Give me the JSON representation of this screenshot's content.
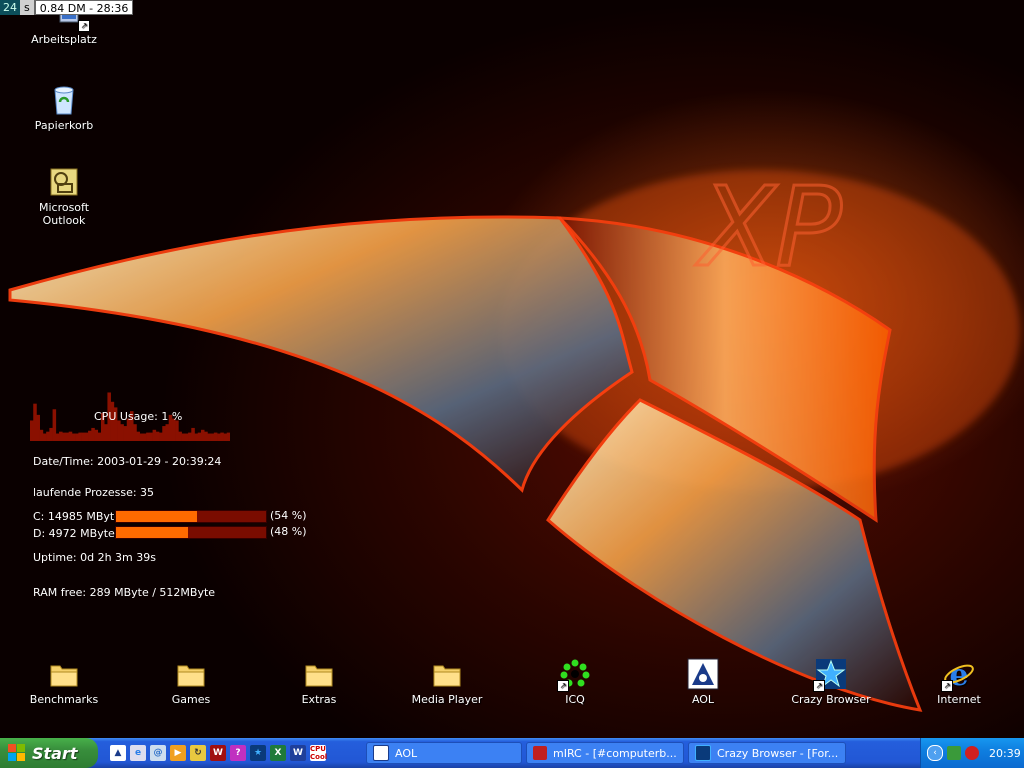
{
  "topbar": {
    "seconds": "24",
    "s": "s",
    "clock": "0.84 DM - 28:36"
  },
  "desktop_icons": {
    "arbeitsplatz": "Arbeitsplatz",
    "papierkorb": "Papierkorb",
    "outlook": "Microsoft Outlook",
    "benchmarks": "Benchmarks",
    "games": "Games",
    "extras": "Extras",
    "media_player": "Media Player",
    "icq": "ICQ",
    "aol": "AOL",
    "crazy_browser": "Crazy Browser",
    "internet": "Internet"
  },
  "monitor": {
    "cpu_usage": "CPU Usage: 1 %",
    "datetime": "Date/Time: 2003-01-29 - 20:39:24",
    "processes": "laufende Prozesse: 35",
    "drive_c": {
      "label": "C: 14985 MByte",
      "pct_text": "(54 %)",
      "fill": 0.54
    },
    "drive_d": {
      "label": "D: 4972 MByte",
      "pct_text": "(48 %)",
      "fill": 0.48
    },
    "uptime": "Uptime: 0d 2h 3m 39s",
    "ram": "RAM free: 289 MByte / 512MByte",
    "cpu_history": [
      22,
      40,
      28,
      12,
      8,
      10,
      14,
      34,
      8,
      10,
      9,
      9,
      10,
      8,
      8,
      9,
      9,
      9,
      11,
      14,
      12,
      9,
      30,
      18,
      52,
      42,
      36,
      22,
      18,
      16,
      24,
      32,
      18,
      10,
      8,
      8,
      9,
      9,
      12,
      10,
      9,
      16,
      18,
      28,
      24,
      22,
      10,
      8,
      8,
      9,
      14,
      8,
      9,
      12,
      10,
      8,
      8,
      9,
      8,
      9,
      8,
      9
    ]
  },
  "taskbar": {
    "start_label": "Start",
    "quicklaunch": [
      "aol-quick-icon",
      "ie-quick-icon",
      "mail-quick-icon",
      "media-quick-icon",
      "refresh-quick-icon",
      "winamp-quick-icon",
      "help-quick-icon",
      "crazy-browser-quick-icon",
      "excel-quick-icon",
      "word-quick-icon",
      "cpu-cool-quick-icon"
    ],
    "tasks": [
      {
        "label": "AOL"
      },
      {
        "label": "mIRC - [#computerb..."
      },
      {
        "label": "Crazy Browser - [For..."
      }
    ],
    "clock": "20:39"
  },
  "colors": {
    "taskbar": "#245edc",
    "start": "#388e3c",
    "drive_fill": "#ff6a00",
    "drive_track": "#7a0c00",
    "cpu_graph": "#8a1000"
  }
}
